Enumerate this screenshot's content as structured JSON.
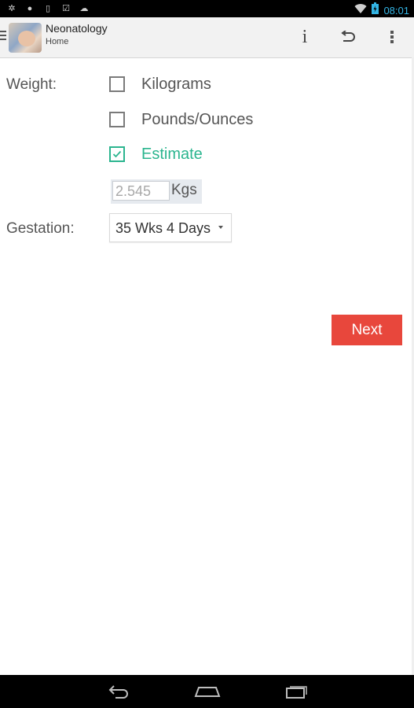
{
  "status_bar": {
    "left_icons": [
      "notification-icon-1",
      "notification-icon-2",
      "usb-icon",
      "checklist-icon",
      "android-icon"
    ],
    "clock": "08:01",
    "accent_color": "#33b5e5"
  },
  "action_bar": {
    "title": "Neonatology",
    "subtitle": "Home",
    "actions": [
      "info-icon",
      "undo-icon",
      "overflow-menu-icon"
    ]
  },
  "form": {
    "weight_label": "Weight:",
    "options": [
      {
        "label": "Kilograms",
        "checked": false
      },
      {
        "label": "Pounds/Ounces",
        "checked": false
      },
      {
        "label": "Estimate",
        "checked": true
      }
    ],
    "weight_value": "2.545",
    "weight_unit": "Kgs",
    "gestation_label": "Gestation:",
    "gestation_value": "35 Wks 4 Days"
  },
  "next_button": {
    "label": "Next",
    "color": "#e8473c"
  },
  "colors": {
    "checked_accent": "#2bb58f"
  }
}
